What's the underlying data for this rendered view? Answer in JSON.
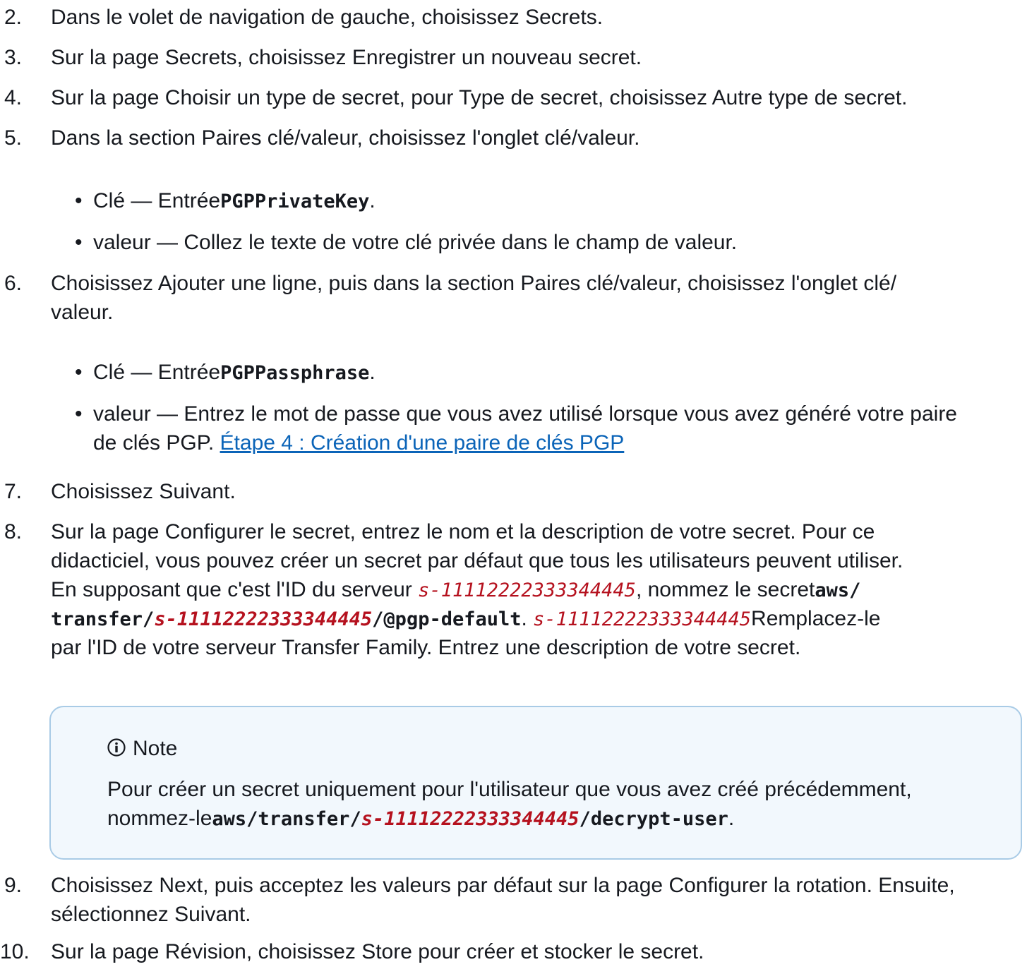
{
  "steps": [
    {
      "num": "2.",
      "text": "Dans le volet de navigation de gauche, choisissez Secrets."
    },
    {
      "num": "3.",
      "text": "Sur la page Secrets, choisissez Enregistrer un nouveau secret."
    },
    {
      "num": "4.",
      "text": "Sur la page Choisir un type de secret, pour Type de secret, choisissez Autre type de secret."
    },
    {
      "num": "5.",
      "text": "Dans la section Paires clé/valeur, choisissez l'onglet clé/valeur.",
      "bullets": [
        {
          "prefix": "Clé — Entrée",
          "code": "PGPPrivateKey",
          "suffix": "."
        },
        {
          "text": "valeur — Collez le texte de votre clé privée dans le champ de valeur."
        }
      ]
    },
    {
      "num": "6.",
      "text": "Choisissez Ajouter une ligne, puis dans la section Paires clé/valeur, choisissez l'onglet clé/",
      "text_line2": "valeur.",
      "bullets": [
        {
          "prefix": "Clé — Entrée",
          "code": "PGPPassphrase",
          "suffix": "."
        },
        {
          "line1": "valeur — Entrez le mot de passe que vous avez utilisé lorsque vous avez généré votre paire",
          "line2_prefix": "de clés PGP. ",
          "link": "Étape 4 : Création d'une paire de clés PGP"
        }
      ]
    },
    {
      "num": "7.",
      "text": "Choisissez Suivant."
    },
    {
      "num": "8.",
      "line1": "Sur la page Configurer le secret, entrez le nom et la description de votre secret. Pour ce",
      "line2": "didacticiel, vous pouvez créer un secret par défaut que tous les utilisateurs peuvent utiliser.",
      "line3_prefix": "En supposant que c'est l'ID du serveur ",
      "server_id": "s-11112222333344445",
      "line3_mid": ", nommez le secret",
      "line3_code": "aws/",
      "line4_code_a": "transfer/",
      "line4_code_b": "/@pgp-default",
      "line4_mid": ". ",
      "line4_suffix": "Remplacez-le",
      "line5": "par l'ID de votre serveur Transfer Family. Entrez une description de votre secret."
    },
    {
      "num": "9.",
      "line1": "Choisissez Next, puis acceptez les valeurs par défaut sur la page Configurer la rotation. Ensuite,",
      "line2": "sélectionnez Suivant."
    },
    {
      "num": "10.",
      "text": "Sur la page Révision, choisissez Store pour créer et stocker le secret."
    }
  ],
  "note": {
    "title": "Note",
    "icon": "info-icon",
    "line1": "Pour créer un secret uniquement pour l'utilisateur que vous avez créé précédemment,",
    "line2_prefix": "nommez-le",
    "code_a": "aws/transfer/",
    "server_id": "s-11112222333344445",
    "code_b": "/decrypt-user",
    "suffix": "."
  },
  "colors": {
    "text": "#16191f",
    "link": "#0b64b8",
    "replaceable": "#b5111e",
    "note_border": "#a9cbe6",
    "note_bg": "#f2f8fd",
    "info_icon": "#16191f"
  }
}
